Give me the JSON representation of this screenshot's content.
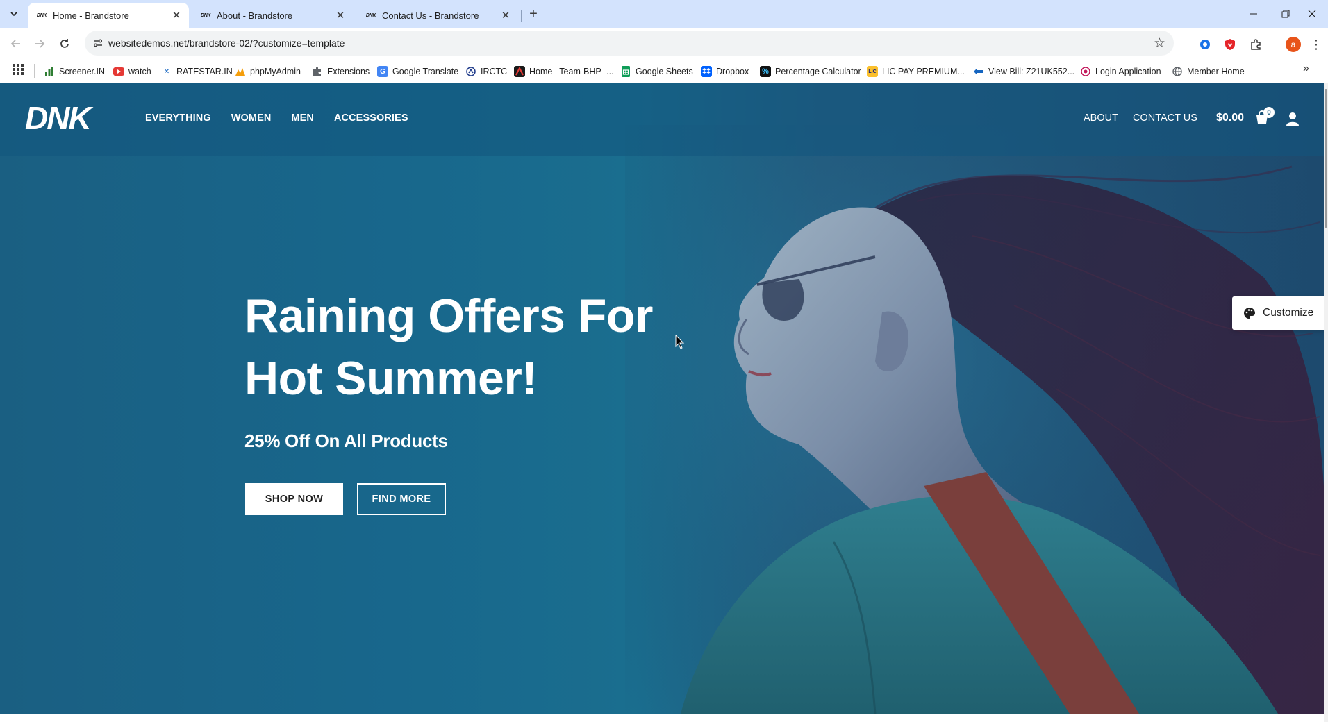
{
  "browser": {
    "tabs": [
      {
        "title": "Home - Brandstore",
        "active": true,
        "favicon": "DNK"
      },
      {
        "title": "About - Brandstore",
        "active": false,
        "favicon": "DNK"
      },
      {
        "title": "Contact Us - Brandstore",
        "active": false,
        "favicon": "DNK"
      }
    ],
    "url": "websitedemos.net/brandstore-02/?customize=template",
    "profile_initial": "a",
    "bookmarks": [
      {
        "label": "Screener.IN",
        "icon": "bar-chart-icon",
        "color": "#2e7d32"
      },
      {
        "label": "watch",
        "icon": "youtube-icon",
        "color": "#e53935"
      },
      {
        "label": "RATESTAR.IN",
        "icon": "ratestar-icon",
        "color": "#1565c0"
      },
      {
        "label": "phpMyAdmin",
        "icon": "phpmyadmin-icon",
        "color": "#f59e0b"
      },
      {
        "label": "Extensions",
        "icon": "puzzle-icon",
        "color": "#5f6368"
      },
      {
        "label": "Google Translate",
        "icon": "translate-icon",
        "color": "#4285f4"
      },
      {
        "label": "IRCTC",
        "icon": "irctc-icon",
        "color": "#1e3a8a"
      },
      {
        "label": "Home | Team-BHP -...",
        "icon": "teambhp-icon",
        "color": "#b71c1c"
      },
      {
        "label": "Google Sheets",
        "icon": "sheets-icon",
        "color": "#0f9d58"
      },
      {
        "label": "Dropbox",
        "icon": "dropbox-icon",
        "color": "#0061fe"
      },
      {
        "label": "Percentage Calculator",
        "icon": "percent-icon",
        "color": "#111111"
      },
      {
        "label": "LIC PAY PREMIUM...",
        "icon": "lic-icon",
        "color": "#1a237e"
      },
      {
        "label": "View Bill: Z21UK552...",
        "icon": "bill-icon",
        "color": "#1565c0"
      },
      {
        "label": "Login Application",
        "icon": "login-icon",
        "color": "#c2185b"
      },
      {
        "label": "Member Home",
        "icon": "globe-icon",
        "color": "#5f6368"
      }
    ]
  },
  "site": {
    "logo": "DNK",
    "nav": [
      "EVERYTHING",
      "WOMEN",
      "MEN",
      "ACCESSORIES"
    ],
    "about": "ABOUT",
    "contact": "CONTACT US",
    "cart_total": "$0.00",
    "cart_count": "0"
  },
  "hero": {
    "title_line1": "Raining Offers For",
    "title_line2": "Hot Summer!",
    "subtitle": "25% Off On All Products",
    "primary_button": "SHOP NOW",
    "secondary_button": "FIND MORE"
  },
  "customize_button": "Customize",
  "colors": {
    "accent": "#1b5d85",
    "tabstrip": "#d3e3fd",
    "omnibox": "#f1f3f4"
  }
}
